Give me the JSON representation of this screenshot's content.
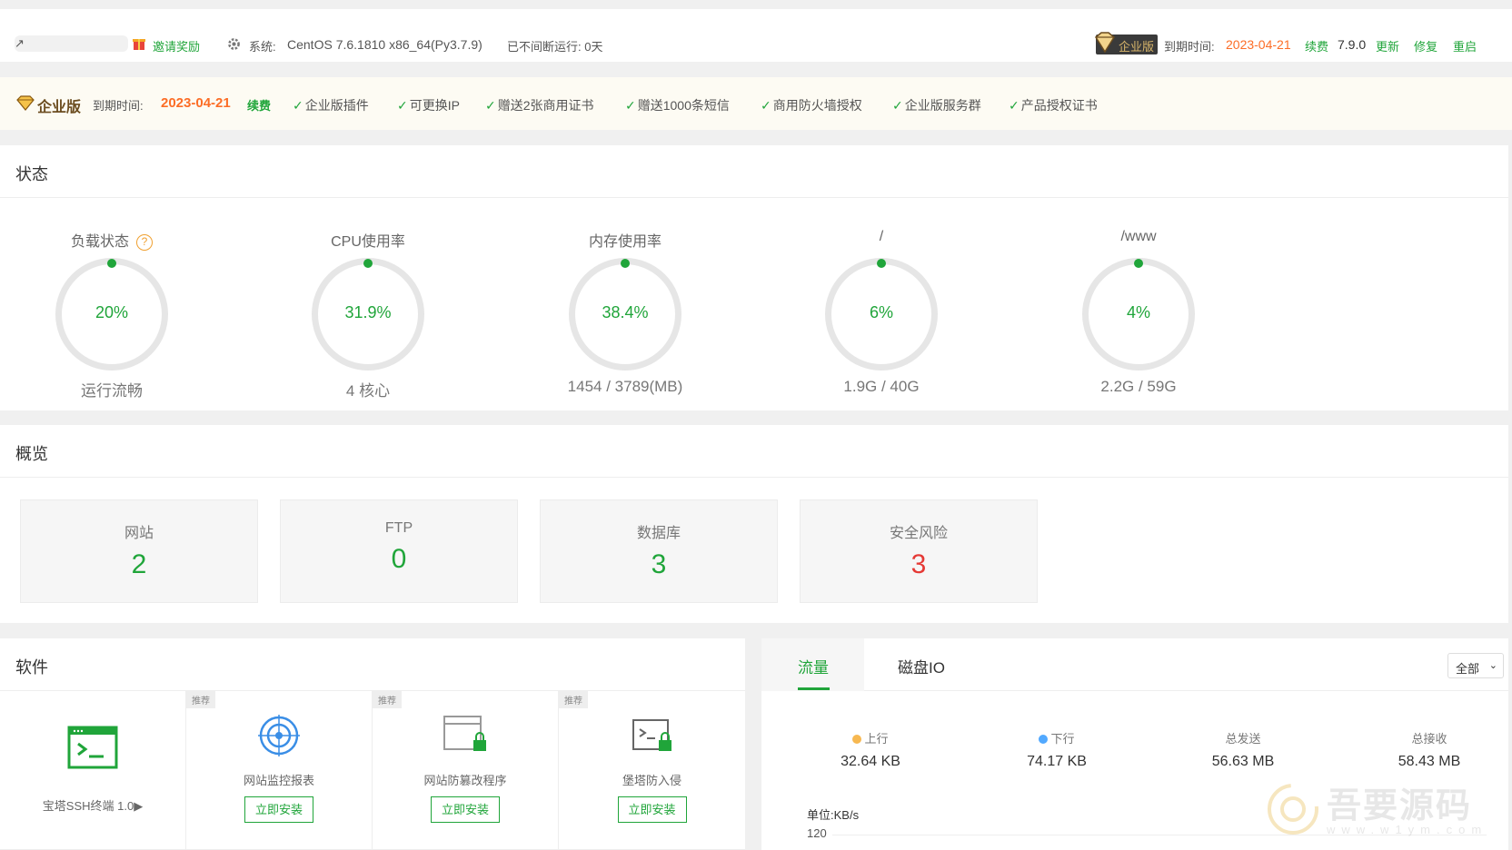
{
  "topbar": {
    "invite": "邀请奖励",
    "sys_label": "系统:",
    "sys_value": "CentOS 7.6.1810 x86_64(Py3.7.9)",
    "uptime": "已不间断运行: 0天",
    "edition_badge": "企业版",
    "expire_label": "到期时间:",
    "expire_date": "2023-04-21",
    "renew": "续费",
    "version": "7.9.0",
    "update": "更新",
    "repair": "修复",
    "restart": "重启"
  },
  "enterprise_bar": {
    "title": "企业版",
    "expire_label": "到期时间:",
    "expire_date": "2023-04-21",
    "renew": "续费",
    "features": [
      "企业版插件",
      "可更换IP",
      "赠送2张商用证书",
      "赠送1000条短信",
      "商用防火墙授权",
      "企业版服务群",
      "产品授权证书"
    ]
  },
  "status": {
    "title": "状态",
    "gauges": [
      {
        "label": "负载状态",
        "value": "20%",
        "sub": "运行流畅"
      },
      {
        "label": "CPU使用率",
        "value": "31.9%",
        "sub": "4 核心"
      },
      {
        "label": "内存使用率",
        "value": "38.4%",
        "sub": "1454 / 3789(MB)"
      },
      {
        "label": "/",
        "value": "6%",
        "sub": "1.9G / 40G"
      },
      {
        "label": "/www",
        "value": "4%",
        "sub": "2.2G / 59G"
      }
    ]
  },
  "overview": {
    "title": "概览",
    "boxes": [
      {
        "label": "网站",
        "value": "2"
      },
      {
        "label": "FTP",
        "value": "0"
      },
      {
        "label": "数据库",
        "value": "3"
      },
      {
        "label": "安全风险",
        "value": "3"
      }
    ]
  },
  "software": {
    "title": "软件",
    "items": [
      {
        "name": "宝塔SSH终端 1.0▶",
        "tag": "",
        "button": ""
      },
      {
        "name": "网站监控报表",
        "tag": "推荐",
        "button": "立即安装"
      },
      {
        "name": "网站防篡改程序",
        "tag": "推荐",
        "button": "立即安装"
      },
      {
        "name": "堡塔防入侵",
        "tag": "推荐",
        "button": "立即安装"
      }
    ]
  },
  "network": {
    "tab_traffic": "流量",
    "tab_disk": "磁盘IO",
    "select": "全部",
    "stats": [
      {
        "label": "上行",
        "value": "32.64 KB",
        "color": "#f7b851"
      },
      {
        "label": "下行",
        "value": "74.17 KB",
        "color": "#52a9ff"
      },
      {
        "label": "总发送",
        "value": "56.63 MB",
        "color": ""
      },
      {
        "label": "总接收",
        "value": "58.43 MB",
        "color": ""
      }
    ],
    "unit": "单位:KB/s",
    "ytick": "120"
  },
  "watermark": {
    "text": "吾要源码",
    "url": "www.w1ym.com"
  },
  "colors": {
    "accent": "#20a53a",
    "warning": "#fc6d26",
    "danger": "#e53935"
  }
}
